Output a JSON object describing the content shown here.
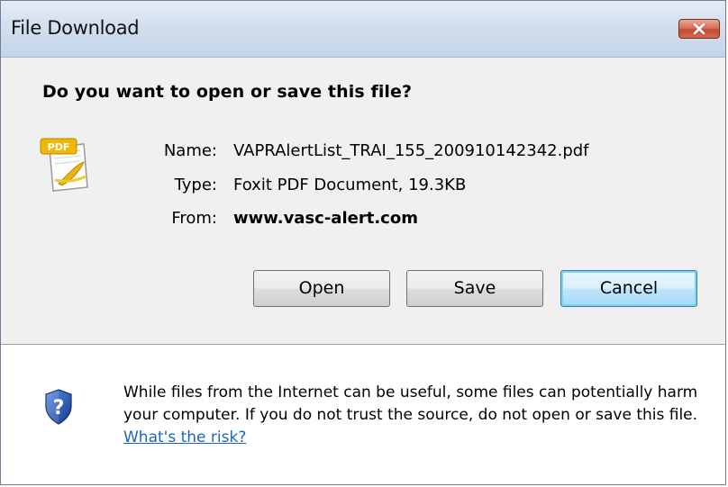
{
  "window": {
    "title": "File Download"
  },
  "dialog": {
    "question": "Do you want to open or save this file?",
    "file": {
      "name_label": "Name:",
      "name_value": "VAPRAlertList_TRAI_155_200910142342.pdf",
      "type_label": "Type:",
      "type_value": "Foxit PDF Document, 19.3KB",
      "from_label": "From:",
      "from_value": "www.vasc-alert.com",
      "icon": "pdf-file-icon"
    },
    "buttons": {
      "open": "Open",
      "save": "Save",
      "cancel": "Cancel"
    }
  },
  "warning": {
    "icon": "security-shield-question-icon",
    "text": "While files from the Internet can be useful, some files can potentially harm your computer. If you do not trust the source, do not open or save this file.",
    "link": "What's the risk?"
  },
  "colors": {
    "link": "#1a65c0",
    "close_button": "#c24a33",
    "default_button_border": "#3c7fb1"
  }
}
